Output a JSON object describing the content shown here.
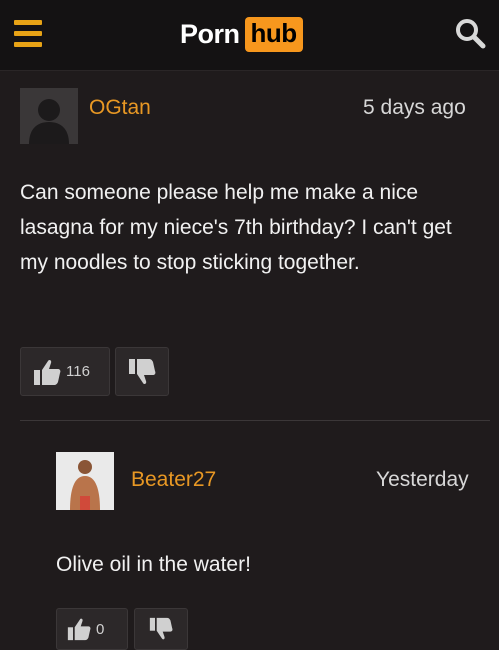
{
  "header": {
    "menu_icon": "hamburger-menu-icon",
    "logo_left": "Porn",
    "logo_right": "hub",
    "search_icon": "search-icon",
    "colors": {
      "accent": "#f7971d",
      "menu": "#e8a316",
      "background": "#141213"
    }
  },
  "comments": [
    {
      "username": "OGtan",
      "timestamp": "5 days ago",
      "text": "Can someone please help me make a nice lasagna for my niece's 7th birthday? I can't get my noodles to stop sticking together.",
      "upvotes": "116",
      "avatar_icon": "default-avatar-icon"
    },
    {
      "username": "Beater27",
      "timestamp": "Yesterday",
      "text": "Olive oil in the water!",
      "upvotes": "0",
      "avatar_icon": "user-photo-avatar"
    }
  ]
}
